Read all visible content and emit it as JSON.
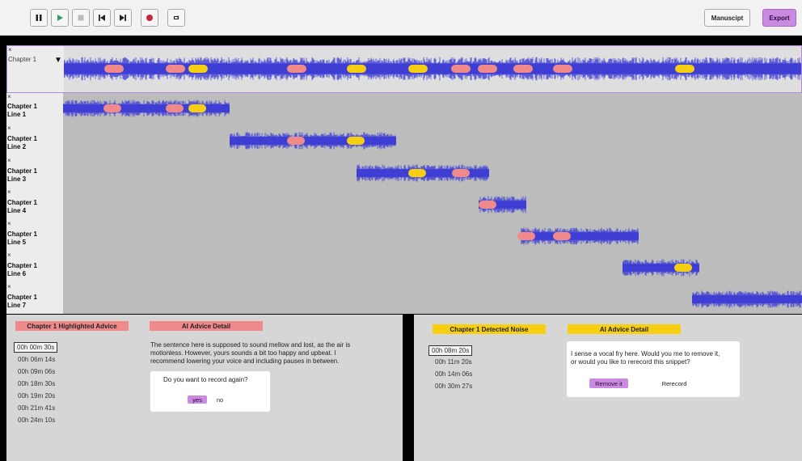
{
  "toolbar": {
    "buttons": [
      "pause-icon",
      "play-icon",
      "stop-icon",
      "skip-back-icon",
      "skip-forward-icon",
      "record-icon",
      "loop-icon"
    ],
    "manuscript_label": "Manuscipt",
    "export_label": "Export"
  },
  "timeline": {
    "master_label": "Chapter 1",
    "tracks": [
      {
        "line1": "Chapter 1",
        "line2": "Line 1"
      },
      {
        "line1": "Chapter 1",
        "line2": "Line 2"
      },
      {
        "line1": "Chapter 1",
        "line2": "Line 3"
      },
      {
        "line1": "Chapter 1",
        "line2": "Line 4"
      },
      {
        "line1": "Chapter 1",
        "line2": "Line 5"
      },
      {
        "line1": "Chapter 1",
        "line2": "Line 6"
      },
      {
        "line1": "Chapter 1",
        "line2": "Line 7"
      }
    ],
    "close_glyph": "×",
    "dropdown_glyph": "▼"
  },
  "left_panel": {
    "tag": "Chapter 1 Highlighted Advice",
    "detail_tag": "AI Advice Detail",
    "timestamps": [
      "00h 00m 30s",
      "00h 06m 14s",
      "00h 09m 06s",
      "00h 18m 30s",
      "00h 19m 20s",
      "00h 21m 41s",
      "00h 24m 10s"
    ],
    "advice_lines": [
      "The sentence here is supposed to sound mellow and lost, as the air is",
      "motionless. However, yours sounds a bit too happy and upbeat. I",
      "recommend lowering your voice and including pauses in between."
    ],
    "question": "Do you want to record again?",
    "yes": "yes",
    "no": "no"
  },
  "right_panel": {
    "tag": "Chapter 1 Detected Noise",
    "detail_tag": "AI Advice Detail",
    "timestamps": [
      "00h 08m 20s",
      "00h 11m 20s",
      "00h 14m 06s",
      "00h 30m 27s"
    ],
    "question_lines": [
      "I sense a vocal fry here. Would you me to remove it,",
      "or would you like to rerecord this snippet?"
    ],
    "remove": "Remove it",
    "rerecord": "Rerecord"
  },
  "colors": {
    "waveform": "#3f3fd4",
    "noise_marker": "#f08a8a",
    "advice_marker": "#f7cf12",
    "accent": "#c98ae0"
  }
}
